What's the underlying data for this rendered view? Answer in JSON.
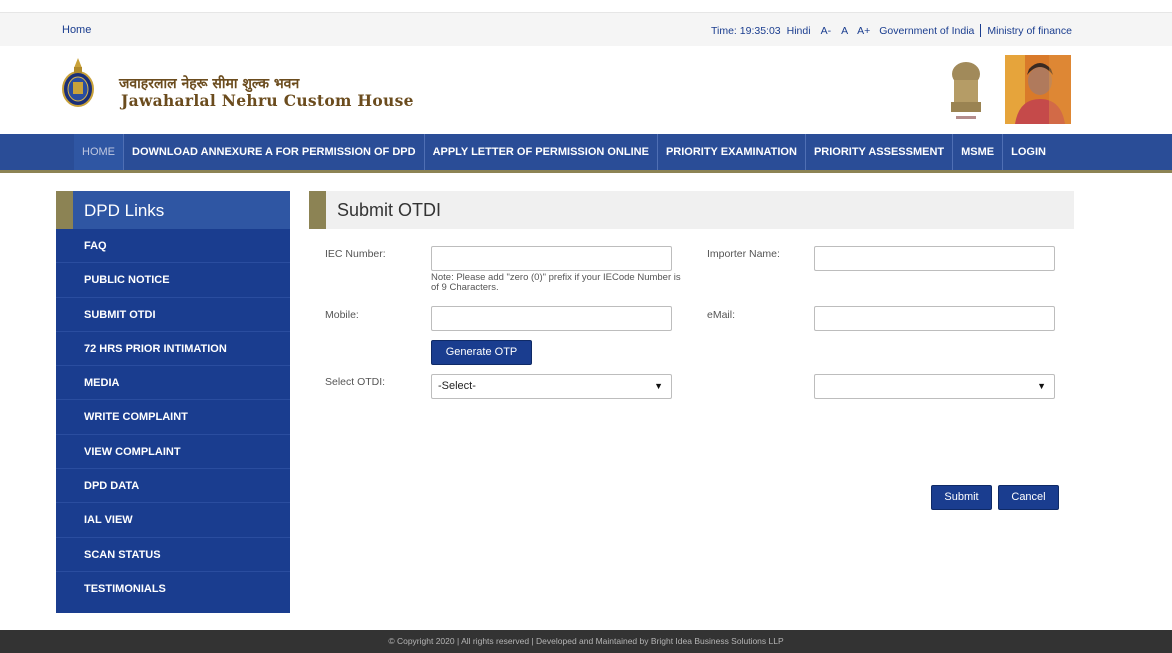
{
  "topbar": {
    "home": "Home",
    "time": "Time: 19:35:03",
    "language": "Hindi",
    "font_decrease": "A-",
    "font_normal": "A",
    "font_increase": "A+",
    "gov": "Government of India",
    "ministry": "Ministry of finance"
  },
  "header": {
    "title_hindi": "जवाहरलाल नेहरू सीमा शुल्क भवन",
    "title_en": "Jawaharlal Nehru Custom House"
  },
  "nav": {
    "items": [
      "HOME",
      "DOWNLOAD ANNEXURE A FOR PERMISSION OF DPD",
      "APPLY LETTER OF PERMISSION ONLINE",
      "PRIORITY EXAMINATION",
      "PRIORITY ASSESSMENT",
      "MSME",
      "LOGIN"
    ]
  },
  "sidebar": {
    "title": "DPD Links",
    "links": [
      "FAQ",
      "PUBLIC NOTICE",
      "SUBMIT OTDI",
      "72 HRS PRIOR INTIMATION",
      "MEDIA",
      "WRITE COMPLAINT",
      "VIEW COMPLAINT",
      "DPD DATA",
      "IAL VIEW",
      "SCAN STATUS",
      "TESTIMONIALS"
    ]
  },
  "form": {
    "title": "Submit OTDI",
    "iec_label": "IEC Number:",
    "iec_value": "",
    "note": "Note: Please add \"zero (0)\" prefix if your IECode Number is of 9 Characters.",
    "importer_label": "Importer Name:",
    "importer_value": "",
    "mobile_label": "Mobile:",
    "mobile_value": "",
    "email_label": "eMail:",
    "email_value": "",
    "generate_otp": "Generate OTP",
    "select_label": "Select OTDI:",
    "select_value": "-Select-",
    "select2_value": "",
    "submit": "Submit",
    "cancel": "Cancel"
  },
  "footer": {
    "text": "© Copyright 2020 | All rights reserved | Developed and Maintained by Bright Idea Business Solutions LLP"
  },
  "colors": {
    "nav_blue": "#2a4d97",
    "sidebar_blue": "#1a3d8f",
    "accent_olive": "#8c8354",
    "footer_dark": "#333333"
  }
}
